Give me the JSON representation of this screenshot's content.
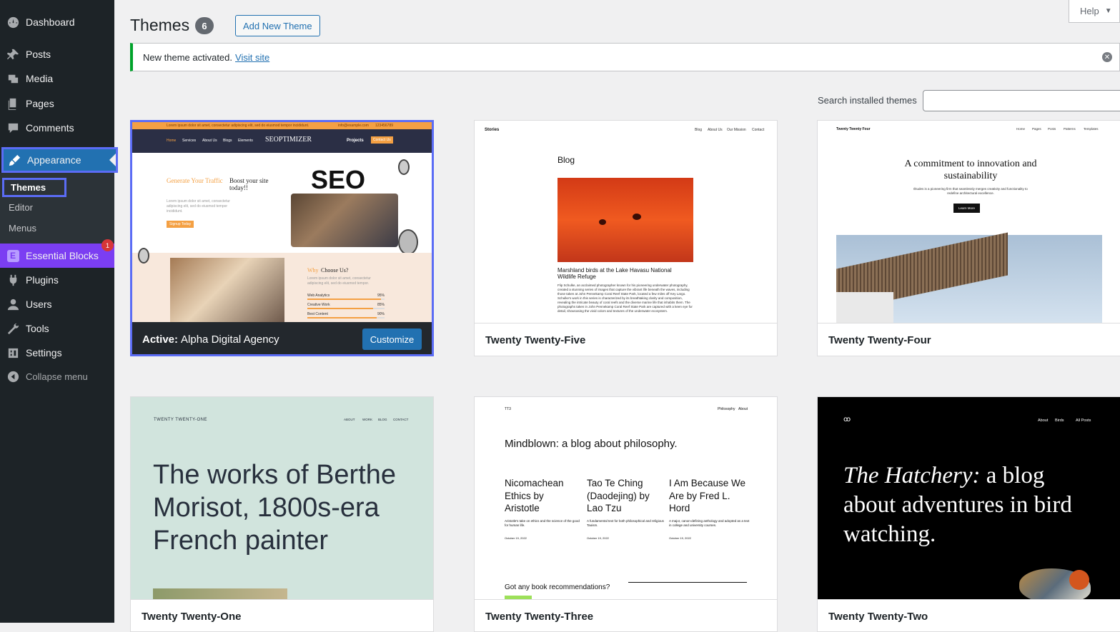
{
  "sidebar": {
    "items": [
      {
        "label": "Dashboard",
        "icon": "dashboard-icon"
      },
      {
        "label": "Posts",
        "icon": "pin-icon"
      },
      {
        "label": "Media",
        "icon": "media-icon"
      },
      {
        "label": "Pages",
        "icon": "pages-icon"
      },
      {
        "label": "Comments",
        "icon": "comments-icon"
      },
      {
        "label": "Appearance",
        "icon": "brush-icon"
      },
      {
        "label": "Essential Blocks",
        "icon": "essential-blocks-icon",
        "badge": "1"
      },
      {
        "label": "Plugins",
        "icon": "plugins-icon"
      },
      {
        "label": "Users",
        "icon": "users-icon"
      },
      {
        "label": "Tools",
        "icon": "wrench-icon"
      },
      {
        "label": "Settings",
        "icon": "settings-icon"
      }
    ],
    "submenu": [
      "Themes",
      "Editor",
      "Menus"
    ],
    "collapse": "Collapse menu"
  },
  "header": {
    "title": "Themes",
    "count": "6",
    "add_new": "Add New Theme",
    "help": "Help"
  },
  "notice": {
    "text": "New theme activated.",
    "link": "Visit site"
  },
  "search": {
    "label": "Search installed themes",
    "value": ""
  },
  "themes": [
    {
      "name": "Alpha Digital Agency",
      "active_label": "Active:",
      "customize": "Customize",
      "preview": {
        "topbar": "Lorem ipsum dolor sit amet, consectetur adipiscing elit, sed do eiusmod tempor incididunt.",
        "email": "info@example.com",
        "phone": "123456789",
        "nav": [
          "Home",
          "Services",
          "About Us",
          "Blogs",
          "Elements"
        ],
        "logo": "SEOPTIMIZER",
        "projects": "Projects",
        "contact": "Contact Us",
        "hero_accent": "Generate Your Traffic",
        "hero_rest": "Boost your site today!!",
        "hero_body": "Lorem ipsum dolor sit amet, consectetur adipiscing elit, sed do eiusmod tempor incididunt.",
        "hero_btn": "Signup Today",
        "seo_word": "SEO",
        "why_accent": "Why",
        "why_rest": "Choose Us?",
        "why_body": "Lorem ipsum dolor sit amet, consectetur adipiscing elit, sed do eiusmod tempor.",
        "bars": [
          {
            "label": "Web Analytics",
            "value": "95%",
            "fill": 0.95
          },
          {
            "label": "Creative Work",
            "value": "85%",
            "fill": 0.85
          },
          {
            "label": "Best Content",
            "value": "90%",
            "fill": 0.9
          }
        ]
      }
    },
    {
      "name": "Twenty Twenty-Five",
      "preview": {
        "site": "Stories",
        "nav": [
          "Blog",
          "About Us",
          "Our Mission",
          "Contact"
        ],
        "heading": "Blog",
        "caption": "Marshland birds at the Lake Havasu National Wildlife Refuge",
        "body": "Flip Schulke, an acclaimed photographer known for his pioneering underwater photography, created a stunning series of images that capture the vibrant life beneath the waves, including those taken at John Pennekamp Coral Reef State Park, located a few miles off Key Largo. Schulke's work in this series is characterized by its breathtaking clarity and composition, revealing the intricate beauty of coral reefs and the diverse marine life that inhabits them. The photographs taken in John Pennekamp Coral Reef State Park are captured with a keen eye for detail, showcasing the vivid colors and textures of the underwater ecosystem."
      }
    },
    {
      "name": "Twenty Twenty-Four",
      "preview": {
        "site": "Twenty Twenty Four",
        "nav": [
          "Home",
          "Pages",
          "Posts",
          "Patterns",
          "Templates"
        ],
        "heading": "A commitment to innovation and sustainability",
        "body": "Études is a pioneering firm that seamlessly merges creativity and functionality to redefine architectural excellence.",
        "button": "Learn More"
      }
    },
    {
      "name": "Twenty Twenty-One",
      "preview": {
        "site": "TWENTY TWENTY-ONE",
        "nav": [
          "ABOUT",
          "WORK",
          "BLOG",
          "CONTACT"
        ],
        "heading": "The works of Berthe Morisot, 1800s-era French painter"
      }
    },
    {
      "name": "Twenty Twenty-Three",
      "preview": {
        "site": "TT3",
        "nav": [
          "Philosophy",
          "About"
        ],
        "heading": "Mindblown: a blog about philosophy.",
        "posts": [
          {
            "title": "Nicomachean Ethics by Aristotle",
            "excerpt": "Aristotle's take on ethics and the science of the good for human life.",
            "date": "October 19, 2022"
          },
          {
            "title": "Tao Te Ching (Daodejing) by Lao Tzu",
            "excerpt": "A fundamental text for both philosophical and religious Taoism.",
            "date": "October 19, 2022"
          },
          {
            "title": "I Am Because We Are by Fred L. Hord",
            "excerpt": "A major, canon-defining anthology and adopted as a text in college and university courses.",
            "date": "October 19, 2022"
          }
        ],
        "footer": "Got any book recommendations?"
      }
    },
    {
      "name": "Twenty Twenty-Two",
      "preview": {
        "nav": [
          "About",
          "Birds",
          "All Posts"
        ],
        "heading_em": "The Hatchery:",
        "heading_rest": "a blog about adventures in bird watching."
      }
    }
  ],
  "colors": {
    "sidebar_bg": "#1d2327",
    "accent": "#2271b1",
    "notice_success": "#00a32a",
    "essential_blocks": "#7b3ef2",
    "highlight": "#5b6cf5"
  }
}
